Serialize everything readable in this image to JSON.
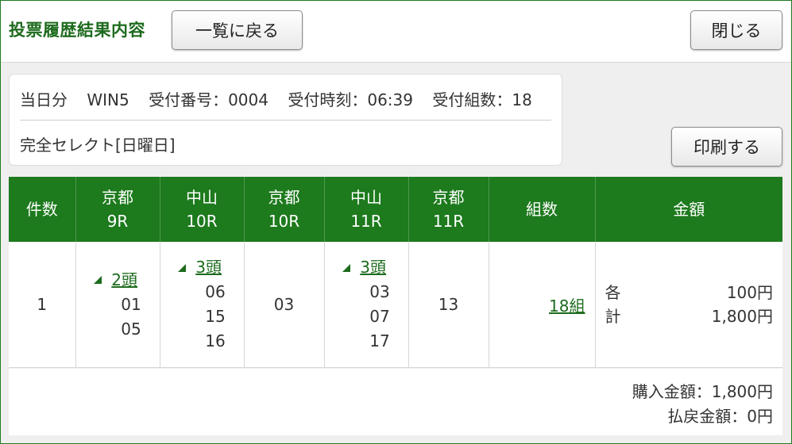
{
  "header": {
    "title": "投票履歴結果内容",
    "back_label": "一覧に戻る",
    "close_label": "閉じる"
  },
  "info": {
    "day": "当日分",
    "bet_type": "WIN5",
    "receipt_no": "受付番号：0004",
    "receipt_time": "受付時刻：06:39",
    "combinations": "受付組数：18",
    "selection": "完全セレクト[日曜日]"
  },
  "print_label": "印刷する",
  "table": {
    "headers": [
      {
        "line1": "件数",
        "line2": ""
      },
      {
        "line1": "京都",
        "line2": "9R"
      },
      {
        "line1": "中山",
        "line2": "10R"
      },
      {
        "line1": "京都",
        "line2": "10R"
      },
      {
        "line1": "中山",
        "line2": "11R"
      },
      {
        "line1": "京都",
        "line2": "11R"
      },
      {
        "line1": "組数",
        "line2": ""
      },
      {
        "line1": "金額",
        "line2": ""
      }
    ],
    "row": {
      "count": "1",
      "race1": {
        "head_label": "2頭",
        "horses": [
          "01",
          "05"
        ]
      },
      "race2": {
        "head_label": "3頭",
        "horses": [
          "06",
          "15",
          "16"
        ]
      },
      "race3": "03",
      "race4": {
        "head_label": "3頭",
        "horses": [
          "03",
          "07",
          "17"
        ]
      },
      "race5": "13",
      "kumi": "18組",
      "amount": {
        "each_label": "各",
        "each_value": "100円",
        "total_label": "計",
        "total_value": "1,800円"
      }
    }
  },
  "footer": {
    "purchase": "購入金額：1,800円",
    "refund": "払戻金額：0円"
  }
}
